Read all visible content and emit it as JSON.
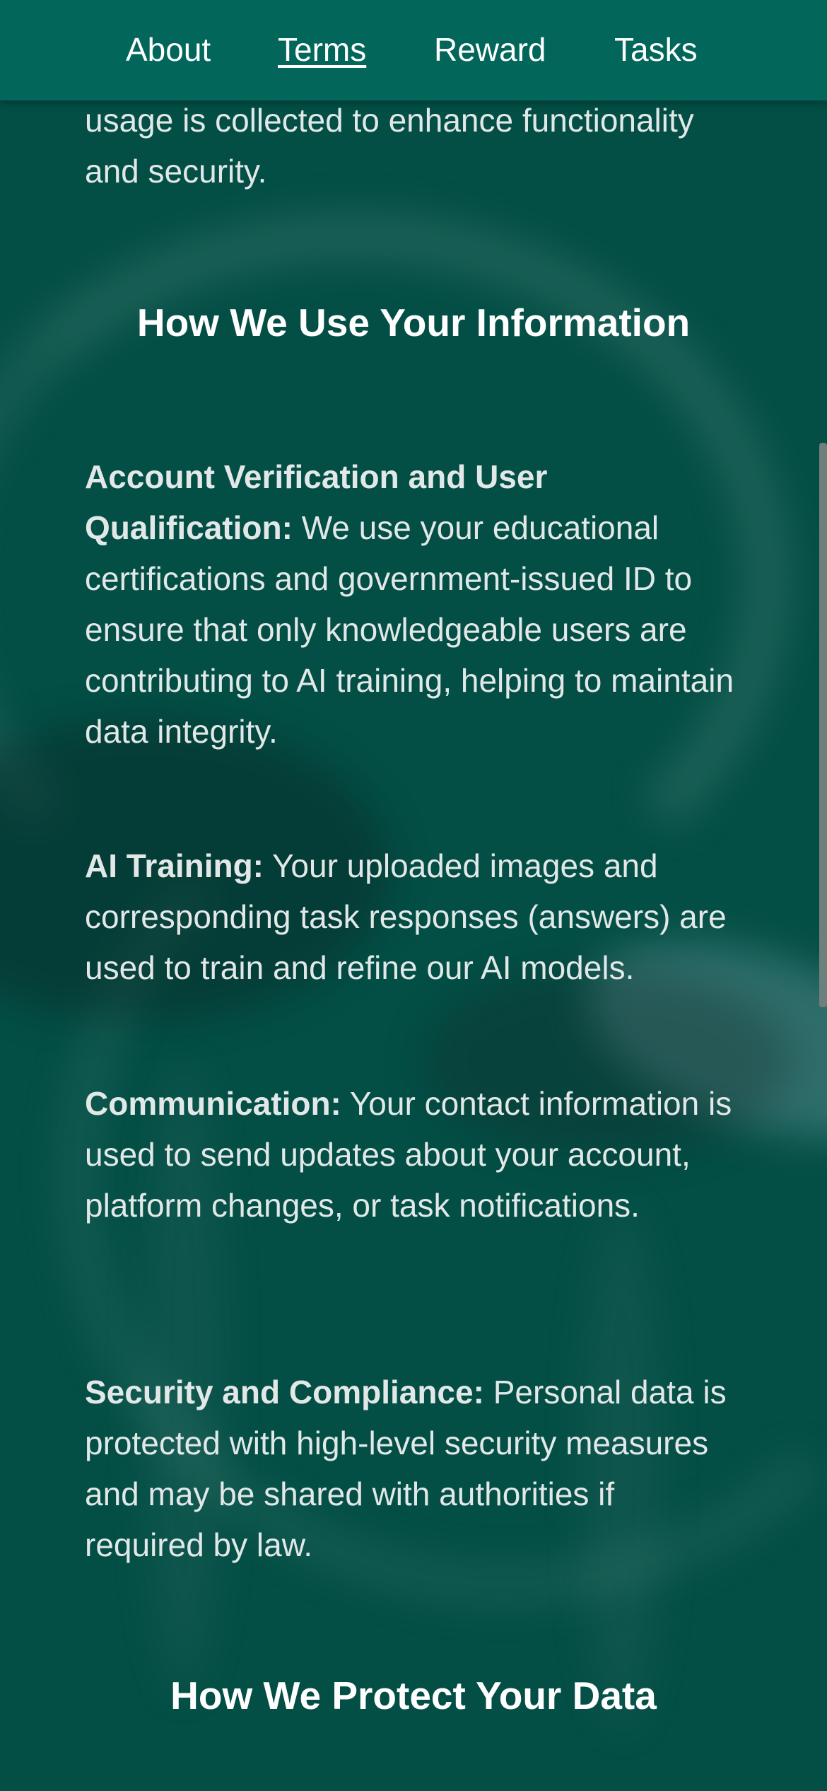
{
  "nav": {
    "items": [
      {
        "label": "About",
        "active": false
      },
      {
        "label": "Terms",
        "active": true
      },
      {
        "label": "Reward",
        "active": false
      },
      {
        "label": "Tasks",
        "active": false
      }
    ]
  },
  "content": {
    "intro_fragment": "usage is collected to enhance functionality and security.",
    "section_use_title": "How We Use Your Information",
    "items": [
      {
        "title": "Account Verification and User Qualification:",
        "text": "We use your educational certifications and government-issued ID to ensure that only knowledgeable users are contributing to AI training, helping to maintain data integrity."
      },
      {
        "title": "AI Training:",
        "text": "Your uploaded images and corresponding task responses (answers) are used to train and refine our AI models."
      },
      {
        "title": "Communication:",
        "text": "Your contact information is used to send updates about your account, platform changes, or task notifications."
      },
      {
        "title": "Security and Compliance:",
        "text": "Personal data is protected with high-level security measures and may be shared with authorities if required by law."
      }
    ],
    "section_protect_title": "How We Protect Your Data"
  },
  "colors": {
    "nav_background": "#02675a",
    "page_background": "#034e45",
    "text": "#e2e8e7"
  }
}
